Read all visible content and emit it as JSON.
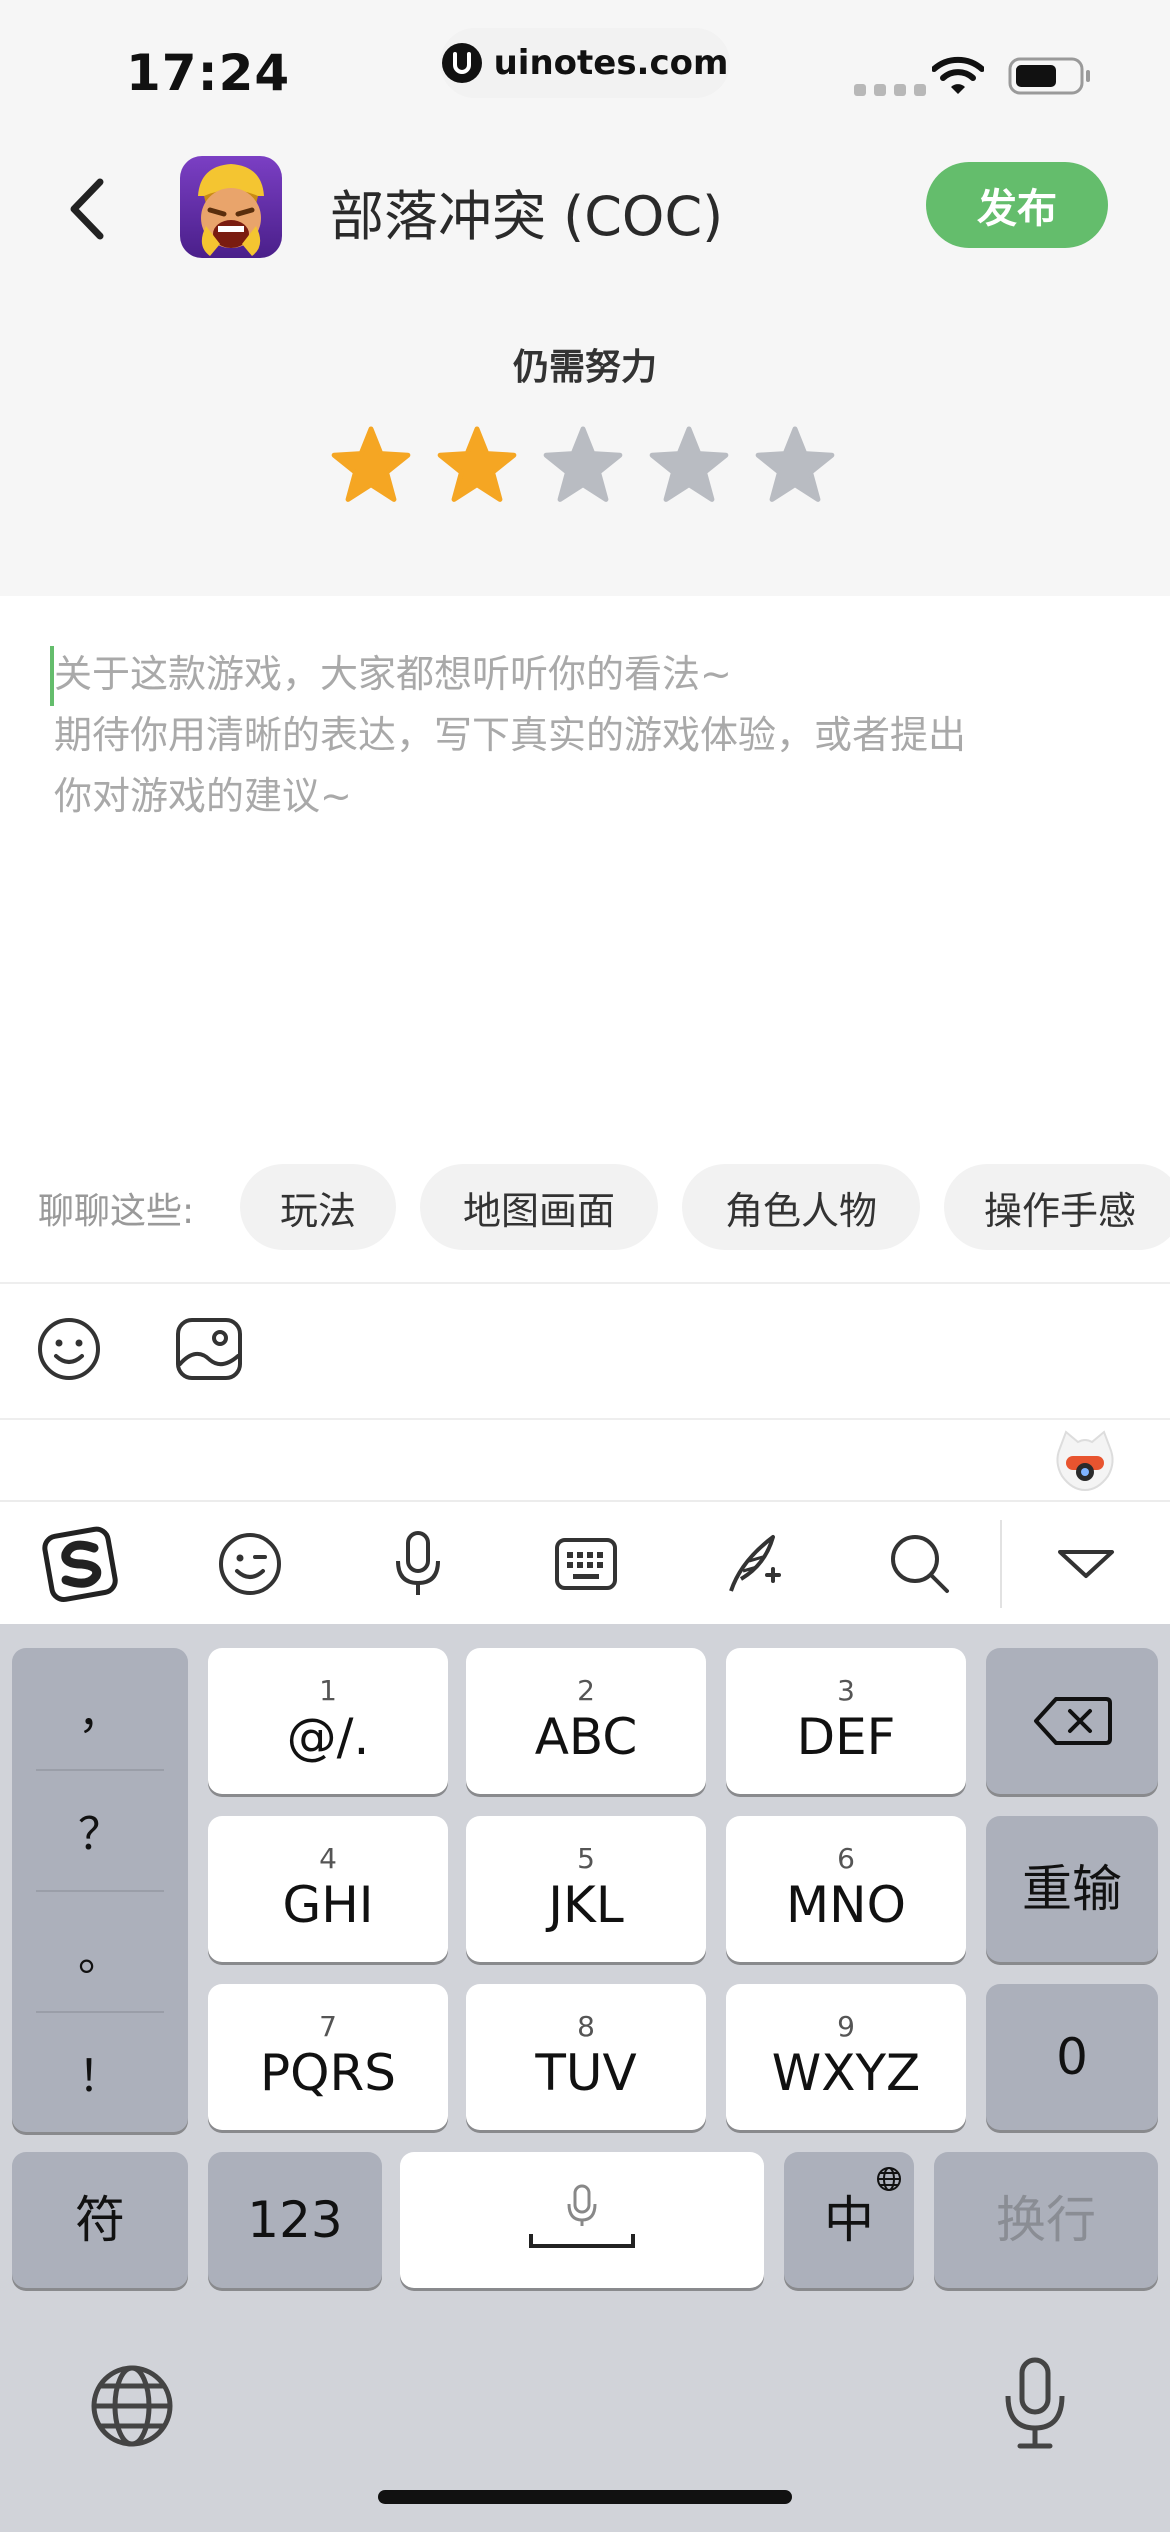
{
  "status_bar": {
    "time": "17:24",
    "url": "uinotes.com"
  },
  "header": {
    "app_title": "部落冲突 (COC)",
    "publish_label": "发布"
  },
  "rating": {
    "label": "仍需努力",
    "value": 2,
    "max": 5,
    "filled_color": "#f5a623",
    "empty_color": "#b9bcc2"
  },
  "editor": {
    "placeholder_lines": [
      "关于这款游戏，大家都想听听你的看法~",
      "期待你用清晰的表达，写下真实的游戏体验，或者提出",
      "你对游戏的建议~"
    ]
  },
  "topics": {
    "label": "聊聊这些:",
    "chips": [
      "玩法",
      "地图画面",
      "角色人物",
      "操作手感"
    ]
  },
  "toolbar": {
    "icons": [
      "emoji-icon",
      "image-icon"
    ]
  },
  "keyboard": {
    "toolbar_icons": [
      "sogou-logo-icon",
      "emoji-icon",
      "microphone-icon",
      "keyboard-icon",
      "quill-icon",
      "search-icon",
      "collapse-icon"
    ],
    "punctuation": [
      "，",
      "？",
      "。",
      "！"
    ],
    "keys": [
      {
        "num": "1",
        "label": "@/."
      },
      {
        "num": "2",
        "label": "ABC"
      },
      {
        "num": "3",
        "label": "DEF"
      },
      {
        "num": "4",
        "label": "GHI"
      },
      {
        "num": "5",
        "label": "JKL"
      },
      {
        "num": "6",
        "label": "MNO"
      },
      {
        "num": "7",
        "label": "PQRS"
      },
      {
        "num": "8",
        "label": "TUV"
      },
      {
        "num": "9",
        "label": "WXYZ"
      }
    ],
    "reenter_label": "重输",
    "zero_label": "0",
    "symbol_label": "符",
    "numeric_label": "123",
    "chinese_label": "中",
    "return_label": "换行"
  },
  "colors": {
    "accent": "#64bd6c",
    "keyboard_bg": "#d1d3d9",
    "dark_key": "#acb0bb"
  }
}
